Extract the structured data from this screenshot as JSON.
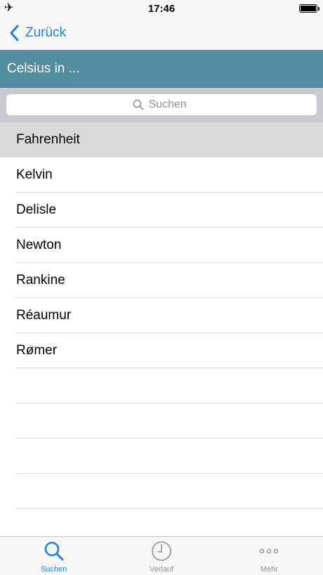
{
  "status_bar": {
    "time": "17:46",
    "airplane_icon": "airplane-icon",
    "battery_level": 1.0
  },
  "nav": {
    "back_label": "Zurück"
  },
  "header": {
    "title": "Celsius in ..."
  },
  "search": {
    "placeholder": "Suchen"
  },
  "list": {
    "items": [
      {
        "label": "Fahrenheit",
        "selected": true
      },
      {
        "label": "Kelvin"
      },
      {
        "label": "Delisle"
      },
      {
        "label": "Newton"
      },
      {
        "label": "Rankine"
      },
      {
        "label": "Réaumur"
      },
      {
        "label": "Rømer"
      }
    ]
  },
  "tabs": [
    {
      "label": "Suchen",
      "icon": "search-icon",
      "active": true
    },
    {
      "label": "Verlauf",
      "icon": "clock-icon"
    },
    {
      "label": "Mehr",
      "icon": "more-icon"
    }
  ],
  "colors": {
    "accent": "#1a82e8",
    "banner": "#538da0",
    "selected_row": "#d9d9d9",
    "inactive_tab": "#929292"
  }
}
